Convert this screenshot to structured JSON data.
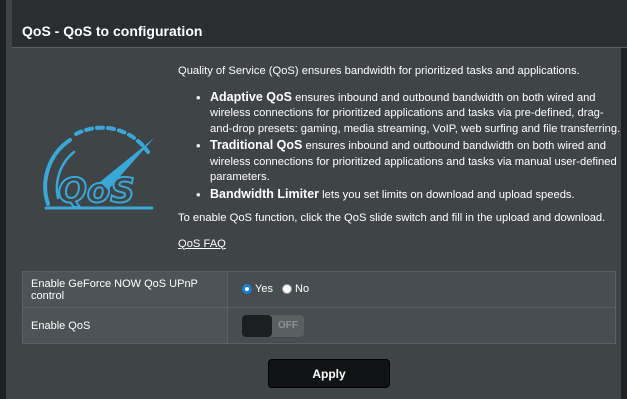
{
  "title": "QoS - QoS to configuration",
  "logo_text": "QoS",
  "intro": "Quality of Service (QoS) ensures bandwidth for prioritized tasks and applications.",
  "features": [
    {
      "name": "Adaptive QoS",
      "desc": " ensures inbound and outbound bandwidth on both wired and wireless connections for prioritized applications and tasks via pre-defined, drag-and-drop presets: gaming, media streaming, VoIP, web surfing and file transferring."
    },
    {
      "name": "Traditional QoS",
      "desc": " ensures inbound and outbound bandwidth on both wired and wireless connections for prioritized applications and tasks via manual user-defined parameters."
    },
    {
      "name": "Bandwidth Limiter",
      "desc": " lets you set limits on download and upload speeds."
    }
  ],
  "enable_note": "To enable QoS function, click the QoS slide switch and fill in the upload and download.",
  "faq_link": "QoS FAQ",
  "settings": {
    "geforce": {
      "label": "Enable GeForce NOW QoS UPnP control",
      "yes": "Yes",
      "no": "No",
      "selected": "Yes"
    },
    "enable_qos": {
      "label": "Enable QoS",
      "toggle_state": "OFF"
    }
  },
  "apply_label": "Apply",
  "colors": {
    "accent": "#1a7dd8",
    "logo": "#3aa7d9",
    "background": "#3f4447"
  }
}
